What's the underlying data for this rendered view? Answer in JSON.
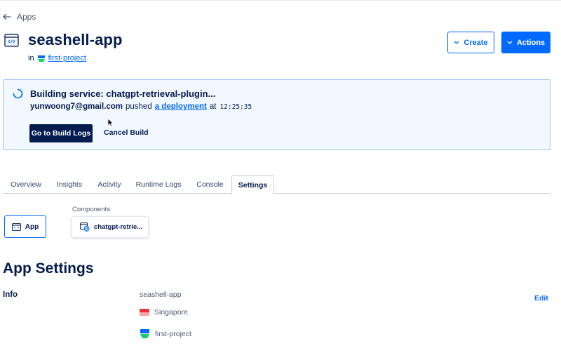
{
  "breadcrumb": {
    "back_label": "Apps"
  },
  "app": {
    "title": "seashell-app",
    "in_label": "in",
    "project_name": "first-project"
  },
  "header_actions": {
    "create_label": "Create",
    "actions_label": "Actions"
  },
  "build": {
    "title": "Building service: chatgpt-retrieval-plugin...",
    "email": "yunwoong7@gmail.com",
    "pushed_text": "pushed",
    "deployment_link": "a deployment",
    "at_text": "at",
    "time": "12:25:35",
    "logs_button": "Go to Build Logs",
    "cancel_button": "Cancel Build"
  },
  "tabs": [
    {
      "label": "Overview",
      "active": false
    },
    {
      "label": "Insights",
      "active": false
    },
    {
      "label": "Activity",
      "active": false
    },
    {
      "label": "Runtime Logs",
      "active": false
    },
    {
      "label": "Console",
      "active": false
    },
    {
      "label": "Settings",
      "active": true
    }
  ],
  "components": {
    "app_label": "App",
    "section_label": "Components:",
    "items": [
      {
        "label": "chatgpt-retrie..."
      }
    ]
  },
  "settings": {
    "heading": "App Settings",
    "info_label": "Info",
    "app_name": "seashell-app",
    "region": "Singapore",
    "project": "first-project",
    "edit_label": "Edit"
  },
  "colors": {
    "brand_blue": "#0069ff",
    "navy": "#031b4e",
    "panel_bg": "#f2f8ff",
    "panel_border": "#9bc1f5"
  },
  "icons": [
    "arrow-left-icon",
    "app-code-icon",
    "project-logo-icon",
    "chevron-down-icon",
    "spinner-icon",
    "mouse-cursor-icon",
    "service-globe-icon",
    "singapore-flag-icon"
  ]
}
